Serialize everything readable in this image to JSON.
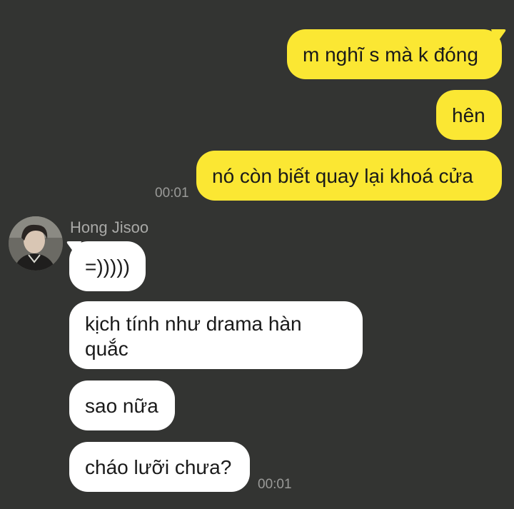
{
  "chat": {
    "outgoing": [
      {
        "text": "m nghĩ s mà k đóng"
      },
      {
        "text": "hên"
      },
      {
        "text": "nó còn biết quay lại khoá cửa"
      }
    ],
    "outgoing_time": "00:01",
    "contact": {
      "name": "Hong Jisoo",
      "avatar_icon": "profile-photo-avatar"
    },
    "incoming": [
      {
        "text": "=)))))"
      },
      {
        "text": "kịch tính như drama hàn quắc"
      },
      {
        "text": "sao nữa"
      },
      {
        "text": "cháo lưỡi chưa?"
      }
    ],
    "incoming_time": "00:01"
  },
  "colors": {
    "background": "#333432",
    "outgoing_bubble": "#fbe733",
    "incoming_bubble": "#ffffff",
    "timestamp": "#9a9a98"
  }
}
